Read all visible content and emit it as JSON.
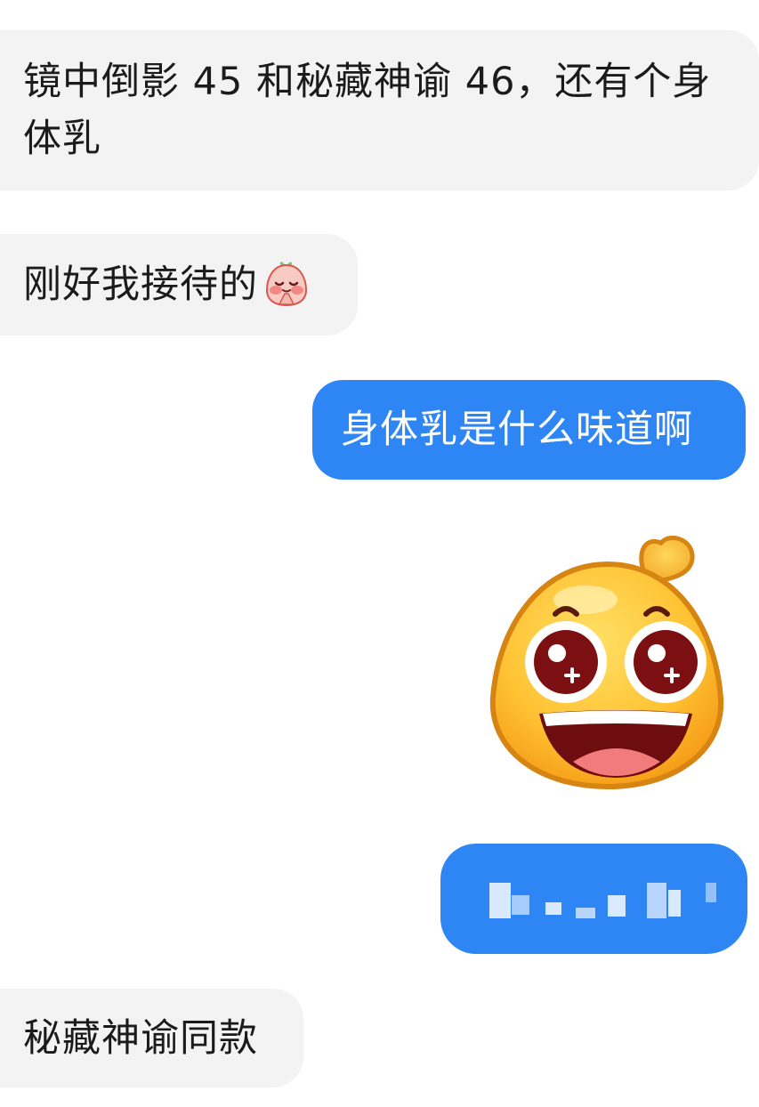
{
  "conversation": {
    "messages": [
      {
        "side": "incoming",
        "text": "镜中倒影 45 和秘藏神谕 46，还有个身体乳"
      },
      {
        "side": "incoming",
        "text": "刚好我接待的",
        "emoji": "blushing-praying-emoji"
      },
      {
        "side": "outgoing",
        "text": "身体乳是什么味道啊"
      },
      {
        "side": "outgoing",
        "sticker": "excited-starry-eyed-bun-sticker"
      },
      {
        "side": "outgoing",
        "text": "",
        "note_visible": "pixelated-redacted-message"
      },
      {
        "side": "incoming",
        "text": "秘藏神谕同款"
      }
    ]
  },
  "colors": {
    "incoming_bubble": "#f3f3f3",
    "outgoing_bubble": "#2e86f5",
    "incoming_text": "#1b1b1b",
    "outgoing_text": "#ffffff"
  }
}
